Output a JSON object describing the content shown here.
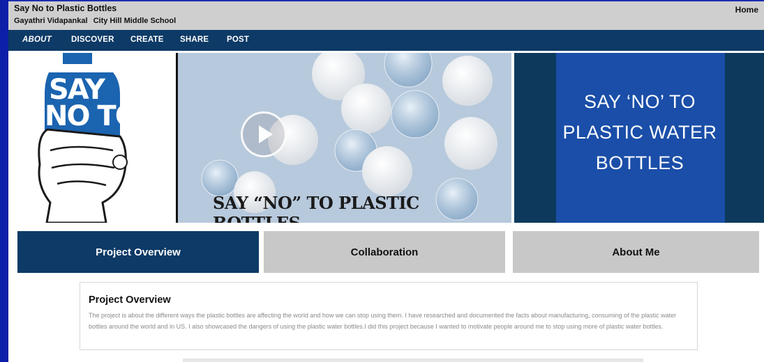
{
  "header": {
    "title": "Say No to Plastic Bottles",
    "author": "Gayathri Vidapankal",
    "school": "City Hill Middle School",
    "home_link": "Home"
  },
  "nav": {
    "items": [
      {
        "label": "ABOUT",
        "active": true
      },
      {
        "label": "DISCOVER",
        "active": false
      },
      {
        "label": "CREATE",
        "active": false
      },
      {
        "label": "SHARE",
        "active": false
      },
      {
        "label": "POST",
        "active": false
      }
    ]
  },
  "banner": {
    "bottle_text_line1": "SAY",
    "bottle_text_line2": "NO TO",
    "video_caption": "SAY “NO” TO PLASTIC BOTTLES",
    "right_text_line1": "SAY ‘NO’ TO",
    "right_text_line2": "PLASTIC WATER",
    "right_text_line3": "BOTTLES"
  },
  "tabs": [
    {
      "label": "Project Overview",
      "active": true
    },
    {
      "label": "Collaboration",
      "active": false
    },
    {
      "label": "About Me",
      "active": false
    }
  ],
  "overview": {
    "heading": "Project Overview",
    "body": "The project is about the different ways the plastic bottles are affecting the world and how we can stop using them. I have researched and documented the facts about manufacturing, consuming of the plastic water bottles around the world and in US. I also showcased the dangers of using the plastic water bottles.I did this project because I wanted to motivate people around me to stop using more of plastic water bottles."
  },
  "colors": {
    "outer_background": "#0c1fa8",
    "nav_background": "#0d3a66",
    "active_tab": "#0d3a66",
    "inactive_tab": "#c8c8c8",
    "header_background": "#cfcfcf"
  }
}
